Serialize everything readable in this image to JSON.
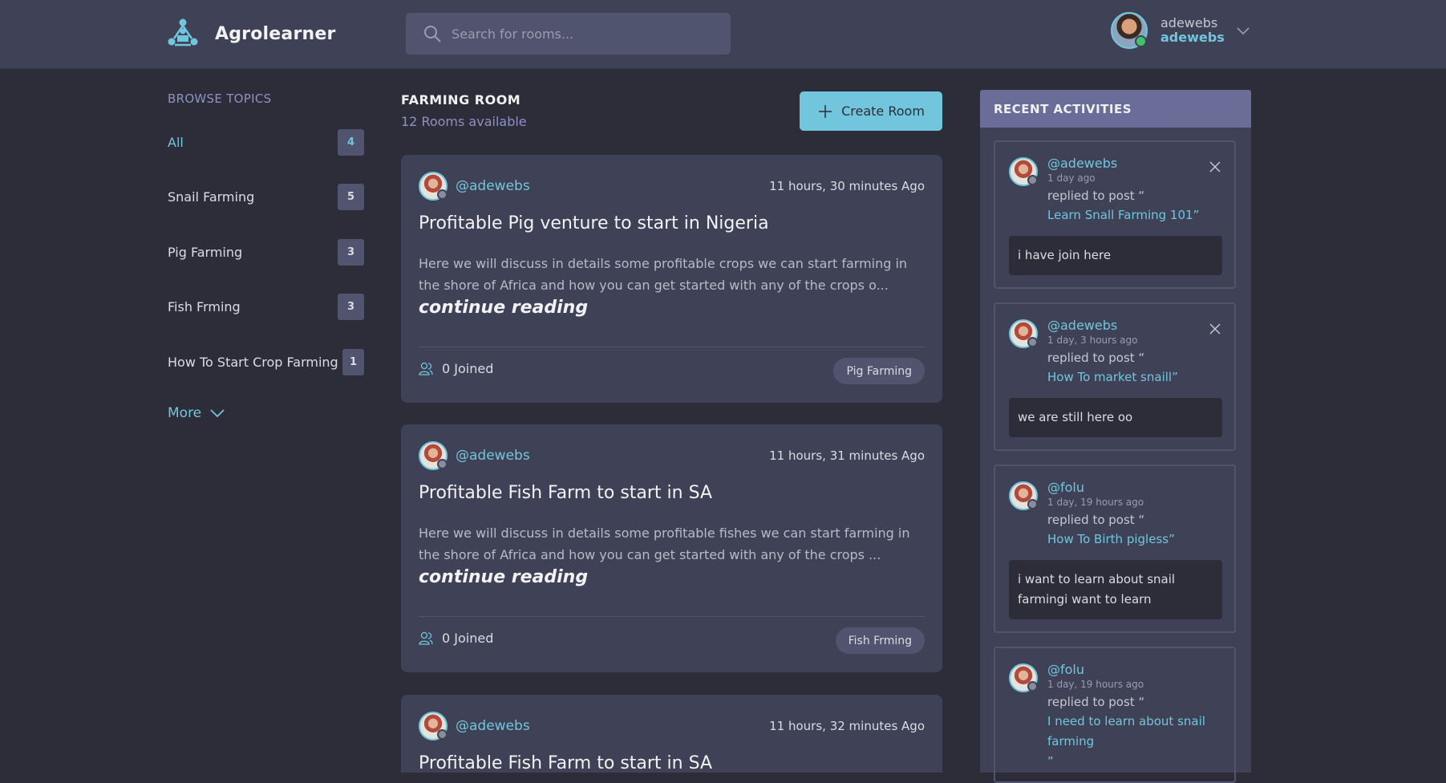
{
  "app": {
    "name": "Agrolearner"
  },
  "search": {
    "placeholder": "Search for rooms..."
  },
  "user": {
    "display_name": "adewebs",
    "username": "adewebs"
  },
  "sidebar": {
    "title": "BROWSE TOPICS",
    "topics": [
      {
        "label": "All",
        "count": "4"
      },
      {
        "label": "Snail Farming",
        "count": "5"
      },
      {
        "label": "Pig Farming",
        "count": "3"
      },
      {
        "label": "Fish Frming",
        "count": "3"
      },
      {
        "label": "How To Start Crop Farming",
        "count": "1"
      }
    ],
    "more_label": "More"
  },
  "feed": {
    "title": "FARMING ROOM",
    "subtitle": "12 Rooms available",
    "create_label": "Create Room",
    "rooms": [
      {
        "host": "@adewebs",
        "time": "11 hours, 30 minutes Ago",
        "title": "Profitable Pig venture to start in Nigeria",
        "description": "Here we will discuss in details some profitable crops we can start farming in the shore of Africa and how you can get started with any of the crops o...",
        "continue": "continue reading",
        "joined": "0 Joined",
        "topic": "Pig Farming"
      },
      {
        "host": "@adewebs",
        "time": "11 hours, 31 minutes Ago",
        "title": "Profitable Fish Farm to start in SA",
        "description": "Here we will discuss in details some profitable fishes we can start farming in the shore of Africa and how you can get started with any of the crops ...",
        "continue": "continue reading",
        "joined": "0 Joined",
        "topic": "Fish Frming"
      },
      {
        "host": "@adewebs",
        "time": "11 hours, 32 minutes Ago",
        "title": "Profitable Fish Farm to start in SA"
      }
    ]
  },
  "activities": {
    "title": "RECENT ACTIVITIES",
    "items": [
      {
        "user": "@adewebs",
        "time": "1 day ago",
        "action": "replied to post “",
        "post": "Learn Snall Farming 101",
        "close_quote": "”",
        "message": "i have join here"
      },
      {
        "user": "@adewebs",
        "time": "1 day, 3 hours ago",
        "action": "replied to post “",
        "post": "How To market snaill",
        "close_quote": "”",
        "message": "we are still here oo"
      },
      {
        "user": "@folu",
        "time": "1 day, 19 hours ago",
        "action": "replied to post “",
        "post": "How To Birth pigless",
        "close_quote": "”",
        "message": "i want to learn about snail farmingi want to learn"
      },
      {
        "user": "@folu",
        "time": "1 day, 19 hours ago",
        "action": "replied to post “",
        "post": "I need to learn about snail farming",
        "close_quote": "”"
      }
    ]
  },
  "colors": {
    "background": "#2d2d39",
    "panel": "#3f4156",
    "accent": "#71c6dd",
    "activity_header": "#696d97"
  }
}
